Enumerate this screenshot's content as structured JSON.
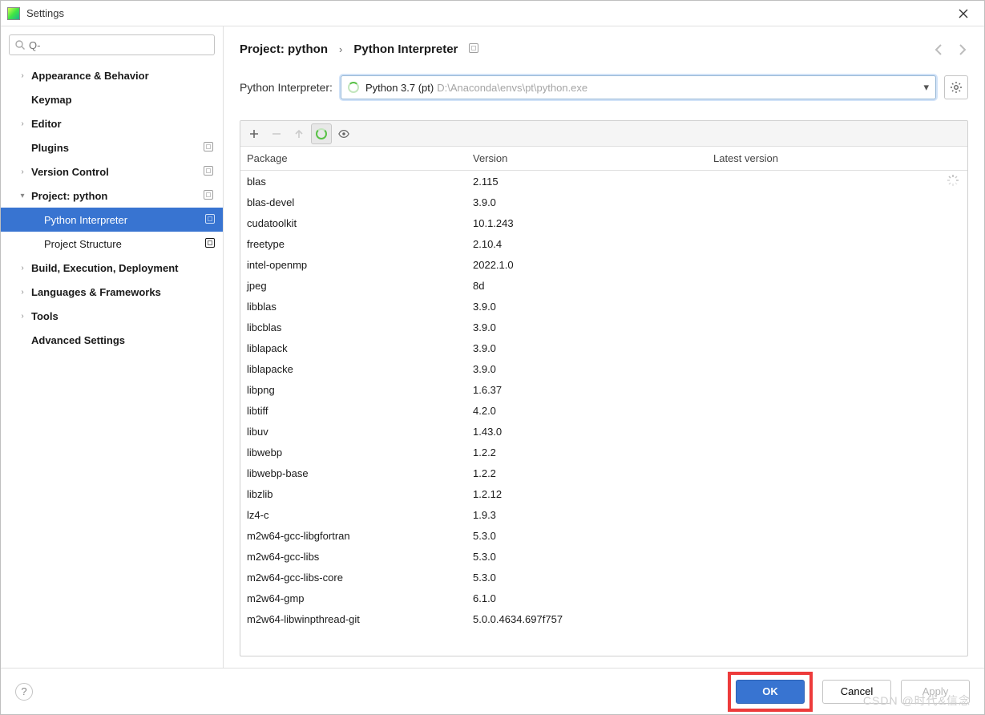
{
  "window": {
    "title": "Settings"
  },
  "search": {
    "placeholder": "Q-"
  },
  "sidebar": {
    "items": [
      {
        "label": "Appearance & Behavior",
        "expandable": true,
        "expanded": false
      },
      {
        "label": "Keymap",
        "expandable": false
      },
      {
        "label": "Editor",
        "expandable": true,
        "expanded": false
      },
      {
        "label": "Plugins",
        "expandable": false,
        "meta": true
      },
      {
        "label": "Version Control",
        "expandable": true,
        "meta": true,
        "expanded": false
      },
      {
        "label": "Project: python",
        "expandable": true,
        "meta": true,
        "expanded": true,
        "children": [
          {
            "label": "Python Interpreter",
            "meta": true,
            "selected": true
          },
          {
            "label": "Project Structure",
            "meta": true,
            "selected": false
          }
        ]
      },
      {
        "label": "Build, Execution, Deployment",
        "expandable": true,
        "expanded": false
      },
      {
        "label": "Languages & Frameworks",
        "expandable": true,
        "expanded": false
      },
      {
        "label": "Tools",
        "expandable": true,
        "expanded": false
      },
      {
        "label": "Advanced Settings",
        "expandable": false
      }
    ]
  },
  "breadcrumb": {
    "a": "Project: python",
    "b": "Python Interpreter"
  },
  "interpreter": {
    "label": "Python Interpreter:",
    "name": "Python 3.7 (pt)",
    "path": "D:\\Anaconda\\envs\\pt\\python.exe"
  },
  "columns": {
    "pkg": "Package",
    "ver": "Version",
    "lat": "Latest version"
  },
  "packages": [
    {
      "name": "blas",
      "version": "2.115"
    },
    {
      "name": "blas-devel",
      "version": "3.9.0"
    },
    {
      "name": "cudatoolkit",
      "version": "10.1.243"
    },
    {
      "name": "freetype",
      "version": "2.10.4"
    },
    {
      "name": "intel-openmp",
      "version": "2022.1.0"
    },
    {
      "name": "jpeg",
      "version": "8d"
    },
    {
      "name": "libblas",
      "version": "3.9.0"
    },
    {
      "name": "libcblas",
      "version": "3.9.0"
    },
    {
      "name": "liblapack",
      "version": "3.9.0"
    },
    {
      "name": "liblapacke",
      "version": "3.9.0"
    },
    {
      "name": "libpng",
      "version": "1.6.37"
    },
    {
      "name": "libtiff",
      "version": "4.2.0"
    },
    {
      "name": "libuv",
      "version": "1.43.0"
    },
    {
      "name": "libwebp",
      "version": "1.2.2"
    },
    {
      "name": "libwebp-base",
      "version": "1.2.2"
    },
    {
      "name": "libzlib",
      "version": "1.2.12"
    },
    {
      "name": "lz4-c",
      "version": "1.9.3"
    },
    {
      "name": "m2w64-gcc-libgfortran",
      "version": "5.3.0"
    },
    {
      "name": "m2w64-gcc-libs",
      "version": "5.3.0"
    },
    {
      "name": "m2w64-gcc-libs-core",
      "version": "5.3.0"
    },
    {
      "name": "m2w64-gmp",
      "version": "6.1.0"
    },
    {
      "name": "m2w64-libwinpthread-git",
      "version": "5.0.0.4634.697f757"
    }
  ],
  "buttons": {
    "ok": "OK",
    "cancel": "Cancel",
    "apply": "Apply"
  },
  "watermark": "CSDN @时代&信念"
}
